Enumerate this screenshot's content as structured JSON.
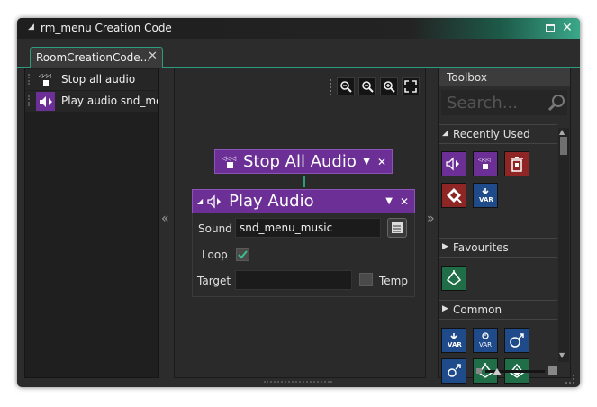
{
  "window": {
    "title": "rm_menu Creation Code",
    "accent_color": "#2e9b7d",
    "max_icon": "maximize-icon",
    "close_icon": "close-icon"
  },
  "tab": {
    "label": "RoomCreationCode...",
    "close_glyph": "✕"
  },
  "action_list": [
    {
      "label": "Stop all audio",
      "icon": "stop-all-audio-icon"
    },
    {
      "label": "Play audio snd_menu",
      "icon": "play-audio-icon"
    }
  ],
  "panel_toggles": {
    "left": "«",
    "right": "»"
  },
  "zoom_tools": [
    "zoom-reset-icon",
    "zoom-out-icon",
    "zoom-in-icon",
    "fit-screen-icon"
  ],
  "blocks": {
    "stop": {
      "title": "Stop All Audio",
      "color": "#6b2f96"
    },
    "play": {
      "title": "Play Audio",
      "color": "#6b2f96",
      "sound_label": "Sound",
      "sound_value": "snd_menu_music",
      "loop_label": "Loop",
      "loop_checked": true,
      "target_label": "Target",
      "target_value": "",
      "temp_label": "Temp",
      "temp_checked": false
    }
  },
  "toolbox": {
    "title": "Toolbox",
    "search_placeholder": "Search...",
    "sections": [
      {
        "label": "Recently Used",
        "items": [
          "play-audio-icon",
          "stop-all-audio-icon",
          "destroy-instance-icon",
          "create-instance-icon",
          "declare-variable-icon"
        ]
      },
      {
        "label": "Favourites",
        "items": [
          "call-function-icon"
        ]
      },
      {
        "label": "Common",
        "items": [
          "assign-variable-icon",
          "declare-temp-icon",
          "function-call-icon",
          "go-to-icon",
          "if-icon",
          "else-icon"
        ]
      }
    ]
  }
}
